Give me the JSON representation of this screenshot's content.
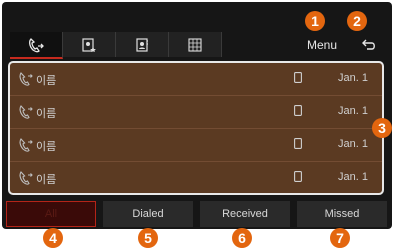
{
  "header": {
    "tabs": [
      {
        "icon": "call-history-icon",
        "active": true
      },
      {
        "icon": "favorites-contacts-icon",
        "active": false
      },
      {
        "icon": "contacts-icon",
        "active": false
      },
      {
        "icon": "dialpad-icon",
        "active": false
      }
    ],
    "menu_label": "Menu",
    "back_icon": "back-arrow-icon"
  },
  "call_list": {
    "rows": [
      {
        "name": "이름",
        "date": "Jan. 1",
        "icon": "outgoing-call-icon",
        "device_icon": "phone-device-icon"
      },
      {
        "name": "이름",
        "date": "Jan. 1",
        "icon": "outgoing-call-icon",
        "device_icon": "phone-device-icon"
      },
      {
        "name": "이름",
        "date": "Jan. 1",
        "icon": "outgoing-call-icon",
        "device_icon": "phone-device-icon"
      },
      {
        "name": "이름",
        "date": "Jan. 1",
        "icon": "outgoing-call-icon",
        "device_icon": "phone-device-icon"
      }
    ]
  },
  "filters": {
    "all": "All",
    "dialed": "Dialed",
    "received": "Received",
    "missed": "Missed",
    "active": "all"
  },
  "callouts": [
    "1",
    "2",
    "3",
    "4",
    "5",
    "6",
    "7"
  ],
  "colors": {
    "accent": "#c62a1e",
    "badge": "#e3660f",
    "list_bg": "#5b3a22",
    "screen_bg": "#161616"
  }
}
